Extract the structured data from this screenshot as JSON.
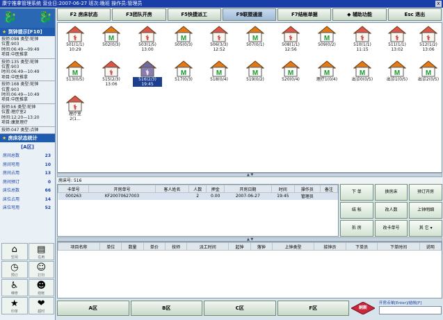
{
  "app": {
    "title": "康宁推拿管理系统  营业日:2007-06-27  班次:晚班  操作员:管理员",
    "close_glyph": "x"
  },
  "menu": [
    {
      "label": "F2  房床状态",
      "active": false
    },
    {
      "label": "F3团队开房",
      "active": false
    },
    {
      "label": "F5快捷派工",
      "active": false
    },
    {
      "label": "F9联盟通道",
      "active": true
    },
    {
      "label": "F7结帐单据",
      "active": false
    },
    {
      "label": "◆  辅助功能",
      "active": false
    },
    {
      "label": "Esc  退出",
      "active": false
    }
  ],
  "sidebar": {
    "hint_header": "到钟提示[F10]",
    "hints": [
      [
        "技师:098  类型:轮钟",
        "位置:903",
        "时间:06:49—09:49",
        "项目:中医推拿"
      ],
      [
        "技师:135  类型:轮钟",
        "位置:903",
        "时间:06:49—10:49",
        "项目:中医推拿"
      ],
      [
        "技师:168  类型:轮钟",
        "位置:903",
        "时间:06:49—10:49",
        "项目:中医推拿"
      ],
      [
        "技师:k6  类型:轮钟",
        "位置:理疗室2",
        "时间:12:20—13:20",
        "项目:康复理疗"
      ],
      [
        "技师:047  类型:点钟"
      ]
    ],
    "stats_header": "房床状态统计",
    "zone_title": "[A区]",
    "stats": [
      {
        "label": "房间总数",
        "value": "23"
      },
      {
        "label": "房间可用",
        "value": "10"
      },
      {
        "label": "房间占用",
        "value": "13"
      },
      {
        "label": "房间预订",
        "value": "0"
      },
      {
        "label": "床位总数",
        "value": "66"
      },
      {
        "label": "床位占用",
        "value": "14"
      },
      {
        "label": "床位可用",
        "value": "52"
      }
    ],
    "tools": [
      {
        "icon": "home-icon",
        "glyph": "⌂",
        "label": "空闲"
      },
      {
        "icon": "book-icon",
        "glyph": "▤",
        "label": "在用"
      },
      {
        "icon": "clock-icon",
        "glyph": "◷",
        "label": "预订"
      },
      {
        "icon": "user-check-icon",
        "glyph": "☺",
        "label": "打扫"
      },
      {
        "icon": "walk-icon",
        "glyph": "♿",
        "label": "维修"
      },
      {
        "icon": "person-icon",
        "glyph": "☻",
        "label": "结帐"
      },
      {
        "icon": "star-icon",
        "glyph": "★",
        "label": "印单"
      },
      {
        "icon": "heart-icon",
        "glyph": "❤",
        "label": "超时"
      }
    ]
  },
  "rooms": [
    {
      "label": "501(1/1)",
      "sub": "10:29",
      "status": "busy"
    },
    {
      "label": "502(0/3)",
      "sub": "",
      "status": "free"
    },
    {
      "label": "503(1/5)",
      "sub": "13:00",
      "status": "busy"
    },
    {
      "label": "505(0/3)",
      "sub": "",
      "status": "free"
    },
    {
      "label": "506(3/3)",
      "sub": "12:52",
      "status": "busy"
    },
    {
      "label": "507(0/1)",
      "sub": "",
      "status": "free"
    },
    {
      "label": "508(1/1)",
      "sub": "12:56",
      "status": "busy"
    },
    {
      "label": "509(0/2)",
      "sub": "",
      "status": "free"
    },
    {
      "label": "510(1/1)",
      "sub": "11:15",
      "status": "busy"
    },
    {
      "label": "511(1/1)",
      "sub": "13:02",
      "status": "busy"
    },
    {
      "label": "512(1/2)",
      "sub": "13:06",
      "status": "busy"
    },
    {
      "label": "513(0/5)",
      "sub": "",
      "status": "free"
    },
    {
      "label": "515(2/3)",
      "sub": "13:06",
      "status": "busy"
    },
    {
      "label": "516(2/3)",
      "sub": "19:45",
      "status": "selected"
    },
    {
      "label": "517(0/3)",
      "sub": "",
      "status": "free"
    },
    {
      "label": "518(0/4)",
      "sub": "",
      "status": "free"
    },
    {
      "label": "519(0/2)",
      "sub": "",
      "status": "free"
    },
    {
      "label": "520(0/4)",
      "sub": "",
      "status": "free"
    },
    {
      "label": "理疗1(0/4)",
      "sub": "",
      "status": "free"
    },
    {
      "label": "出诊0(0/5)",
      "sub": "",
      "status": "free"
    },
    {
      "label": "出诊1(0/5)",
      "sub": "",
      "status": "free"
    },
    {
      "label": "出诊2(0/5)",
      "sub": "",
      "status": "free"
    },
    {
      "label": "理疗室",
      "sub": "2(1...",
      "status": "busy"
    }
  ],
  "room_info": {
    "label": "房床号",
    "value": "516"
  },
  "orders": {
    "columns": [
      "卡单号",
      "开房单号",
      "客人姓名",
      "人数",
      "押金",
      "开房日期",
      "时间",
      "操作员",
      "备注"
    ],
    "rows": [
      [
        "000263",
        "KF20070627003",
        "",
        "2",
        "0.00",
        "2007-06-27",
        "19:45",
        "管理员",
        ""
      ]
    ]
  },
  "actions": [
    "下  单",
    "换房床",
    "预订开房",
    "结  帐",
    "改人数",
    "上钟明细",
    "拆  房",
    "改卡单号",
    "其  它  ▾"
  ],
  "details": {
    "columns": [
      "项目名称",
      "单位",
      "数量",
      "单价",
      "技师",
      "派工时间",
      "起钟",
      "落钟",
      "上钟类型",
      "接钟员",
      "下单员",
      "下单时间",
      "说明"
    ],
    "rows": []
  },
  "zones": [
    "A区",
    "B区",
    "C区",
    "F区"
  ],
  "refresh": {
    "label": "刷新"
  },
  "quick": {
    "label": "开房点单[Enter]/结帐[F]",
    "value": ""
  }
}
